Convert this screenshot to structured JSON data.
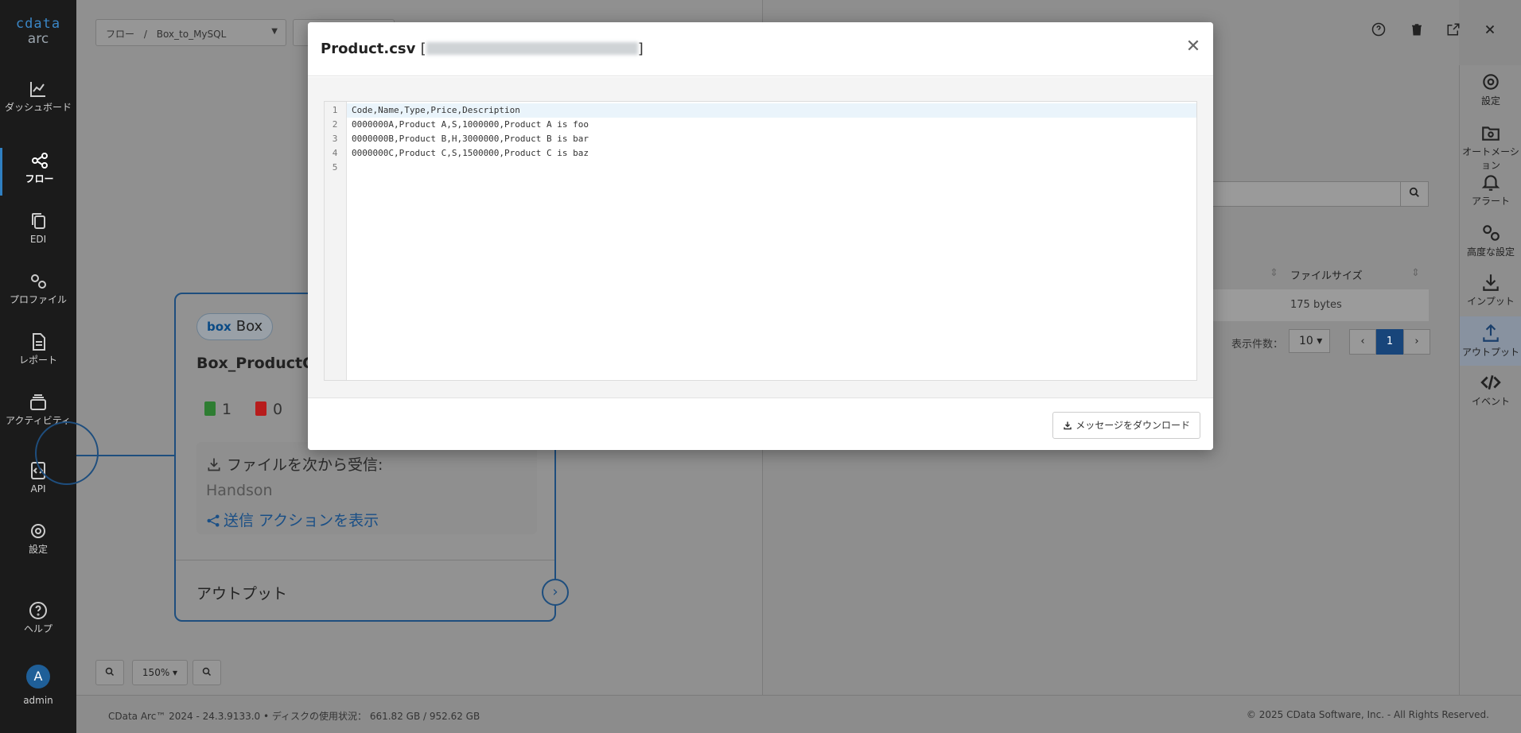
{
  "nav": {
    "brand": "cdata",
    "product": "arc",
    "items": [
      {
        "label": "ダッシュボード",
        "icon": "chart-line-icon"
      },
      {
        "label": "フロー",
        "icon": "flow-icon"
      },
      {
        "label": "EDI",
        "icon": "copy-icon"
      },
      {
        "label": "プロファイル",
        "icon": "gears-icon"
      },
      {
        "label": "レポート",
        "icon": "document-icon"
      },
      {
        "label": "アクティビティ",
        "icon": "layers-icon"
      },
      {
        "label": "API",
        "icon": "code-file-icon"
      },
      {
        "label": "設定",
        "icon": "gear-icon"
      },
      {
        "label": "ヘルプ",
        "icon": "help-icon"
      }
    ],
    "active": "フロー",
    "user": {
      "initial": "A",
      "name": "admin"
    }
  },
  "breadcrumb": {
    "root": "フロー",
    "separator": "/",
    "flow": "Box_to_MySQL"
  },
  "node": {
    "badge_logo": "box",
    "badge_label": "Box",
    "title": "Box_ProductCSV",
    "success_count": "1",
    "error_count": "0",
    "receive_label": "ファイルを次から受信:",
    "source": "Handson",
    "show_actions": "送信 アクションを表示",
    "output_label": "アウトプット"
  },
  "zoom": {
    "level": "150%"
  },
  "right_panel": {
    "search_icon": "search-icon",
    "column_filesize": "ファイルサイズ",
    "row_filesize": "175 bytes",
    "per_page_label": "表示件数：",
    "per_page_value": "10",
    "current_page": "1"
  },
  "right_bar": {
    "items": [
      {
        "label": "設定",
        "icon": "gear-icon"
      },
      {
        "label": "オートメーション",
        "icon": "folder-gear-icon"
      },
      {
        "label": "アラート",
        "icon": "bell-icon"
      },
      {
        "label": "高度な設定",
        "icon": "gears-icon"
      },
      {
        "label": "インプット",
        "icon": "download-icon"
      },
      {
        "label": "アウトプット",
        "icon": "upload-icon"
      },
      {
        "label": "イベント",
        "icon": "code-icon"
      }
    ],
    "active": "アウトプット"
  },
  "footer": {
    "left": "CData Arc™ 2024 - 24.3.9133.0  •  ディスクの使用状況： 661.82 GB / 952.62 GB",
    "right": "© 2025 CData Software, Inc. - All Rights Reserved."
  },
  "modal": {
    "filename": "Product.csv",
    "bracket_open": "[",
    "bracket_close": "]",
    "close_icon": "close-icon",
    "lines": [
      "Code,Name,Type,Price,Description",
      "0000000A,Product A,S,1000000,Product A is foo",
      "0000000B,Product B,H,3000000,Product B is bar",
      "0000000C,Product C,S,1500000,Product C is baz",
      ""
    ],
    "line_numbers": [
      "1",
      "2",
      "3",
      "4",
      "5"
    ],
    "download_label": "メッセージをダウンロード"
  }
}
